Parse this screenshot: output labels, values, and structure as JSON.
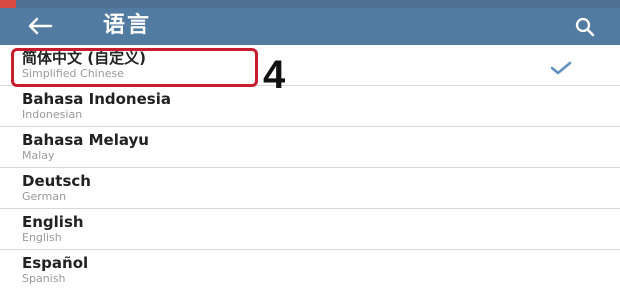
{
  "header": {
    "title": "语言"
  },
  "icons": {
    "back": "arrow-left-icon",
    "search": "search-icon",
    "selected": "check-icon"
  },
  "annotation": {
    "step": "4"
  },
  "languages": [
    {
      "title": "简体中文 (自定义)",
      "subtitle": "Simplified Chinese",
      "selected": true
    },
    {
      "title": "Bahasa Indonesia",
      "subtitle": "Indonesian",
      "selected": false
    },
    {
      "title": "Bahasa Melayu",
      "subtitle": "Malay",
      "selected": false
    },
    {
      "title": "Deutsch",
      "subtitle": "German",
      "selected": false
    },
    {
      "title": "English",
      "subtitle": "English",
      "selected": false
    },
    {
      "title": "Español",
      "subtitle": "Spanish",
      "selected": false
    }
  ],
  "colors": {
    "appbar": "#517ba1",
    "highlight": "#c81d2d",
    "check": "#5f8fbc"
  }
}
